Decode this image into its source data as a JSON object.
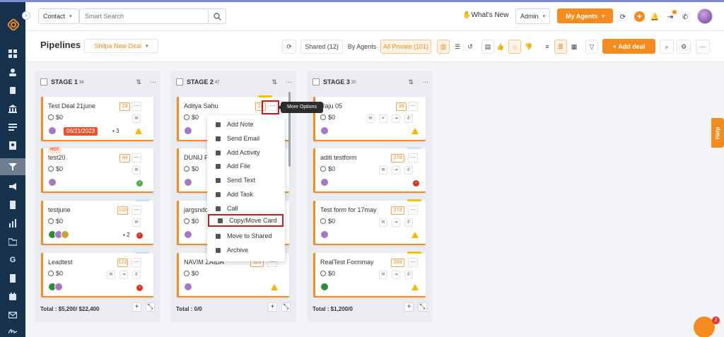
{
  "topbar": {
    "contact_select": "Contact",
    "search_placeholder": "Smart Search",
    "whats_new": "What's New",
    "admin_select": "Admin",
    "my_agents": "My Agents"
  },
  "subbar": {
    "title": "Pipelines",
    "pipeline_select": "Shilpa New Deal",
    "shared": "Shared (12)",
    "by_agents": "By Agents",
    "all_private": "All Private (101)",
    "add_deal": "+ Add deal"
  },
  "columns": [
    {
      "name": "STAGE 1",
      "count": "34",
      "total": "Total : $5,200/ $22,400",
      "cards": [
        {
          "title": "Test Deal 21june",
          "amount": "$0",
          "days": "2d",
          "date": "06/21/2023",
          "notes": "3"
        },
        {
          "title": "test20",
          "amount": "$0",
          "days": "4d",
          "hot": "HOT"
        },
        {
          "title": "testjune",
          "amount": "$0",
          "days": "11d",
          "notes": "2"
        },
        {
          "title": "Leadtest",
          "amount": "$0",
          "days": "12d"
        }
      ]
    },
    {
      "name": "STAGE 2",
      "count": "47",
      "total": "Total : 0/0",
      "cards": [
        {
          "title": "Aditya Sahu",
          "amount": "$0",
          "days": "2d"
        },
        {
          "title": "DUNIJ PU",
          "amount": "$0"
        },
        {
          "title": "jargsndo",
          "amount": "$0"
        },
        {
          "title": "NAVIM ZAIDA",
          "amount": "$0",
          "days": "32d"
        }
      ]
    },
    {
      "name": "STAGE 3",
      "count": "20",
      "total": "Total : $1,200/0",
      "cards": [
        {
          "title": "Raju 05",
          "amount": "$0",
          "days": "3d"
        },
        {
          "title": "aditi testform",
          "amount": "$0",
          "days": "27d"
        },
        {
          "title": "Test form for 17may",
          "amount": "$0",
          "days": "27d"
        },
        {
          "title": "RealTest Formmay",
          "amount": "$0",
          "days": "28d"
        }
      ]
    }
  ],
  "menu": [
    "Add Note",
    "Send Email",
    "Add Activity",
    "Add File",
    "Send Text",
    "Add Task",
    "Call",
    "Copy/Move Card",
    "Move to Shared",
    "Archive"
  ],
  "tooltip": "More Options",
  "help": "Help",
  "chat_badge": "2",
  "colors": {
    "accent": "#f38b1f",
    "sidebar": "#17324d",
    "highlight": "#c01d22"
  }
}
